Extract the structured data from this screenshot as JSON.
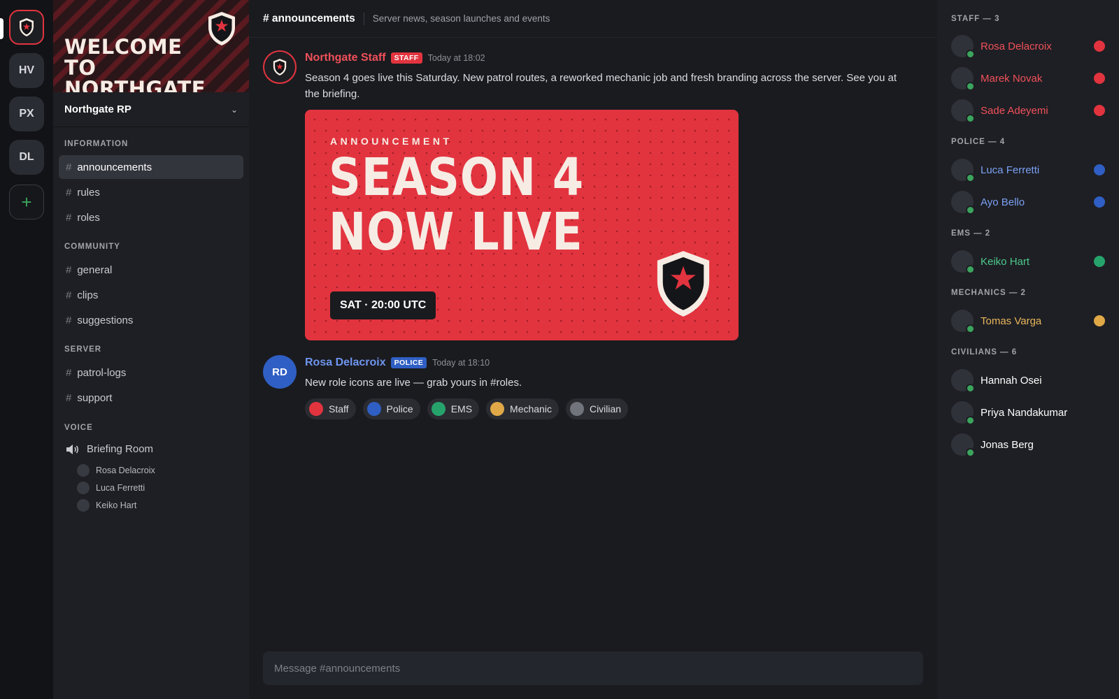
{
  "colors": {
    "staff": "#e2343f",
    "police": "#2f5fc4",
    "ems": "#26a36b",
    "mechanic": "#e0a847",
    "civilian": "#72747c",
    "online": "#3ba55d"
  },
  "servers": [
    {
      "label": "",
      "icon": "shield-icon",
      "active": true
    },
    {
      "label": "HV"
    },
    {
      "label": "PX"
    },
    {
      "label": "DL"
    },
    {
      "label": "+",
      "icon": "plus-icon"
    }
  ],
  "banner": {
    "title": "WELCOME TO NORTHGATE",
    "icon": "shield-star-icon"
  },
  "guild": {
    "name": "Northgate RP",
    "chevron": "⌄"
  },
  "categories": {
    "information": "INFORMATION",
    "community": "COMMUNITY",
    "server": "SERVER",
    "voice": "VOICE"
  },
  "channels": {
    "announcements": "announcements",
    "rules": "rules",
    "roles": "roles",
    "general": "general",
    "clips": "clips",
    "suggestions": "suggestions",
    "patrol_logs": "patrol-logs",
    "support": "support",
    "hash": "#"
  },
  "voice": {
    "room": "Briefing Room",
    "icon": "speaker-icon",
    "users": [
      "Rosa Delacroix",
      "Luca Ferretti",
      "Keiko Hart"
    ]
  },
  "topbar": {
    "channel": "# announcements",
    "topic": "Server news, season launches and events"
  },
  "messages": [
    {
      "author": "Northgate Staff",
      "badge": "STAFF",
      "time": "Today at 18:02",
      "text": "Season 4 goes live this Saturday. New patrol routes, a reworked mechanic job and fresh branding across the server. See you at the briefing.",
      "embed": {
        "kicker": "ANNOUNCEMENT",
        "line1": "SEASON 4",
        "line2": "NOW LIVE",
        "date": "SAT · 20:00 UTC"
      }
    },
    {
      "author": "Rosa Delacroix",
      "initials": "RD",
      "badge": "POLICE",
      "time": "Today at 18:10",
      "text": "New role icons are live — grab yours in #roles.",
      "roles": [
        "Staff",
        "Police",
        "EMS",
        "Mechanic",
        "Civilian"
      ]
    }
  ],
  "composer": {
    "placeholder": "Message #announcements"
  },
  "member_groups": [
    {
      "title": "STAFF — 3",
      "role": "staff",
      "members": [
        "Rosa Delacroix",
        "Marek Novak",
        "Sade Adeyemi"
      ]
    },
    {
      "title": "POLICE — 4",
      "role": "police",
      "members": [
        "Luca Ferretti",
        "Ayo Bello"
      ]
    },
    {
      "title": "EMS — 2",
      "role": "ems",
      "members": [
        "Keiko Hart"
      ]
    },
    {
      "title": "MECHANICS — 2",
      "role": "mechanic",
      "members": [
        "Tomas Varga"
      ]
    },
    {
      "title": "CIVILIANS — 6",
      "role": "civilian",
      "members": [
        "Hannah Osei",
        "Priya Nandakumar",
        "Jonas Berg"
      ]
    }
  ]
}
